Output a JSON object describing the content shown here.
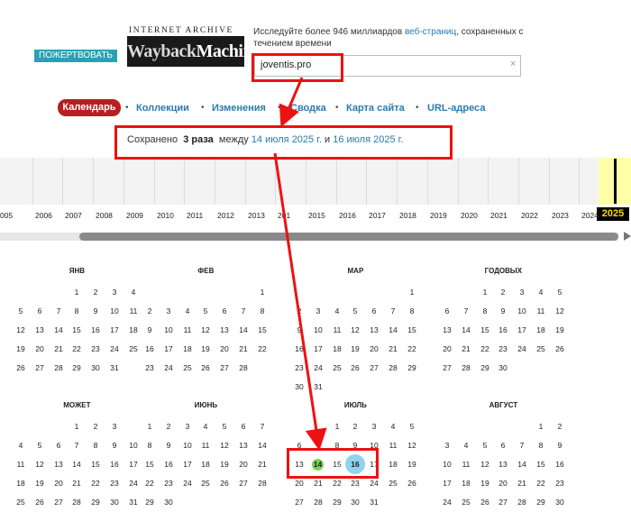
{
  "header": {
    "donate_label": "ПОЖЕРТВОВАТЬ",
    "logo_top": "INTERNET ARCHIVE",
    "logo_main_a": "Wayback",
    "logo_main_b": "Machine",
    "tagline_prefix": "Исследуйте более 946 миллиардов",
    "tagline_link": "веб-страниц",
    "tagline_suffix": ", сохраненных с течением времени",
    "url_value": "joventis.pro",
    "clear_icon": "×"
  },
  "nav": {
    "active": "Календарь",
    "items": [
      "Коллекции",
      "Изменения",
      "Сводка",
      "Карта сайта",
      "URL-адреса"
    ]
  },
  "saved": {
    "prefix": "Сохранено",
    "count": "3 раза",
    "between": "между",
    "date_from": "14 июля 2025 г.",
    "and": "и",
    "date_to": "16 июля 2025 г."
  },
  "timeline": {
    "years": [
      "005",
      "2006",
      "2007",
      "2008",
      "2009",
      "2010",
      "2011",
      "2012",
      "2013",
      "201",
      "2015",
      "2016",
      "2017",
      "2018",
      "2019",
      "2020",
      "2021",
      "2022",
      "2023",
      "2024"
    ],
    "current_year": "2025"
  },
  "calendar": {
    "months": [
      {
        "name": "ЯНВ",
        "weeks": [
          [
            "",
            "",
            "",
            "1",
            "2",
            "3",
            "4"
          ],
          [
            "5",
            "6",
            "7",
            "8",
            "9",
            "10",
            "11"
          ],
          [
            "12",
            "13",
            "14",
            "15",
            "16",
            "17",
            "18"
          ],
          [
            "19",
            "20",
            "21",
            "22",
            "23",
            "24",
            "25"
          ],
          [
            "26",
            "27",
            "28",
            "29",
            "30",
            "31",
            ""
          ]
        ]
      },
      {
        "name": "ФЕВ",
        "weeks": [
          [
            "",
            "",
            "",
            "",
            "",
            "",
            "1"
          ],
          [
            "2",
            "3",
            "4",
            "5",
            "6",
            "7",
            "8"
          ],
          [
            "9",
            "10",
            "11",
            "12",
            "13",
            "14",
            "15"
          ],
          [
            "16",
            "17",
            "18",
            "19",
            "20",
            "21",
            "22"
          ],
          [
            "23",
            "24",
            "25",
            "26",
            "27",
            "28",
            ""
          ]
        ]
      },
      {
        "name": "МАР",
        "weeks": [
          [
            "",
            "",
            "",
            "",
            "",
            "",
            "1"
          ],
          [
            "2",
            "3",
            "4",
            "5",
            "6",
            "7",
            "8"
          ],
          [
            "9",
            "10",
            "11",
            "12",
            "13",
            "14",
            "15"
          ],
          [
            "16",
            "17",
            "18",
            "19",
            "20",
            "21",
            "22"
          ],
          [
            "23",
            "24",
            "25",
            "26",
            "27",
            "28",
            "29"
          ],
          [
            "30",
            "31",
            "",
            "",
            "",
            "",
            ""
          ]
        ]
      },
      {
        "name": "ГОДОВЫХ",
        "weeks": [
          [
            "",
            "",
            "1",
            "2",
            "3",
            "4",
            "5"
          ],
          [
            "6",
            "7",
            "8",
            "9",
            "10",
            "11",
            "12"
          ],
          [
            "13",
            "14",
            "15",
            "16",
            "17",
            "18",
            "19"
          ],
          [
            "20",
            "21",
            "22",
            "23",
            "24",
            "25",
            "26"
          ],
          [
            "27",
            "28",
            "29",
            "30",
            "",
            "",
            ""
          ]
        ]
      },
      {
        "name": "МОЖЕТ",
        "weeks": [
          [
            "",
            "",
            "",
            "1",
            "2",
            "3"
          ],
          [
            "4",
            "5",
            "6",
            "7",
            "8",
            "9",
            "10"
          ],
          [
            "11",
            "12",
            "13",
            "14",
            "15",
            "16",
            "17"
          ],
          [
            "18",
            "19",
            "20",
            "21",
            "22",
            "23",
            "24"
          ],
          [
            "25",
            "26",
            "27",
            "28",
            "29",
            "30",
            "31"
          ]
        ]
      },
      {
        "name": "ИЮНЬ",
        "weeks": [
          [
            "1",
            "2",
            "3",
            "4",
            "5",
            "6",
            "7"
          ],
          [
            "8",
            "9",
            "10",
            "11",
            "12",
            "13",
            "14"
          ],
          [
            "15",
            "16",
            "17",
            "18",
            "19",
            "20",
            "21"
          ],
          [
            "22",
            "23",
            "24",
            "25",
            "26",
            "27",
            "28"
          ],
          [
            "29",
            "30",
            "",
            "",
            "",
            "",
            ""
          ]
        ]
      },
      {
        "name": "ИЮЛЬ",
        "weeks": [
          [
            "",
            "",
            "1",
            "2",
            "3",
            "4",
            "5"
          ],
          [
            "6",
            "7",
            "8",
            "9",
            "10",
            "11",
            "12"
          ],
          [
            "13",
            "14",
            "15",
            "16",
            "17",
            "18",
            "19"
          ],
          [
            "20",
            "21",
            "22",
            "23",
            "24",
            "25",
            "26"
          ],
          [
            "27",
            "28",
            "29",
            "30",
            "31",
            "",
            ""
          ]
        ]
      },
      {
        "name": "АВГУСТ",
        "weeks": [
          [
            "",
            "",
            "",
            "",
            "",
            "1",
            "2"
          ],
          [
            "3",
            "4",
            "5",
            "6",
            "7",
            "8",
            "9"
          ],
          [
            "10",
            "11",
            "12",
            "13",
            "14",
            "15",
            "16"
          ],
          [
            "17",
            "18",
            "19",
            "20",
            "21",
            "22",
            "23"
          ],
          [
            "24",
            "25",
            "26",
            "27",
            "28",
            "29",
            "30"
          ]
        ]
      }
    ],
    "marked": {
      "month": "ИЮЛЬ",
      "green": "14",
      "blue": "16"
    }
  },
  "colors": {
    "donate": "#2aa1b3",
    "nav_active": "#b5211f",
    "link": "#2a7ab0",
    "annotation": "#ee1111",
    "current_year_bg": "#ffffaa",
    "capture_green": "#7ccf5a",
    "capture_blue": "#8fd3ef"
  }
}
